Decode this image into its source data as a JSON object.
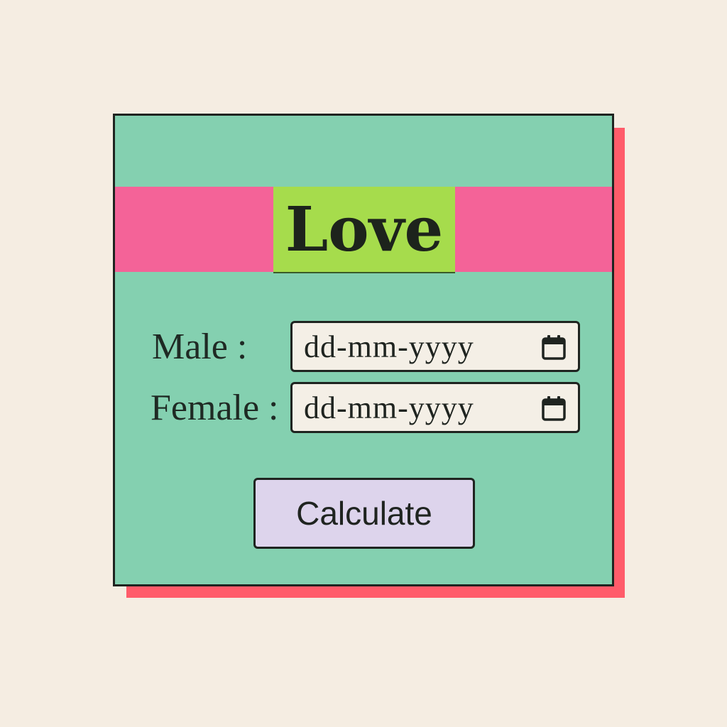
{
  "title": "Love",
  "form": {
    "male": {
      "label": "Male :",
      "placeholder": "dd-mm-yyyy",
      "icon": "calendar-icon"
    },
    "female": {
      "label": "Female :",
      "placeholder": "dd-mm-yyyy",
      "icon": "calendar-icon"
    },
    "submit_label": "Calculate"
  },
  "colors": {
    "page_background": "#f5ede2",
    "card_background": "#84d0b0",
    "card_shadow": "#ff5c6a",
    "banner": "#f46398",
    "title_background": "#a6dc4c",
    "input_background": "#f4efe6",
    "button_background": "#ddd4ec",
    "border": "#1f2420"
  }
}
